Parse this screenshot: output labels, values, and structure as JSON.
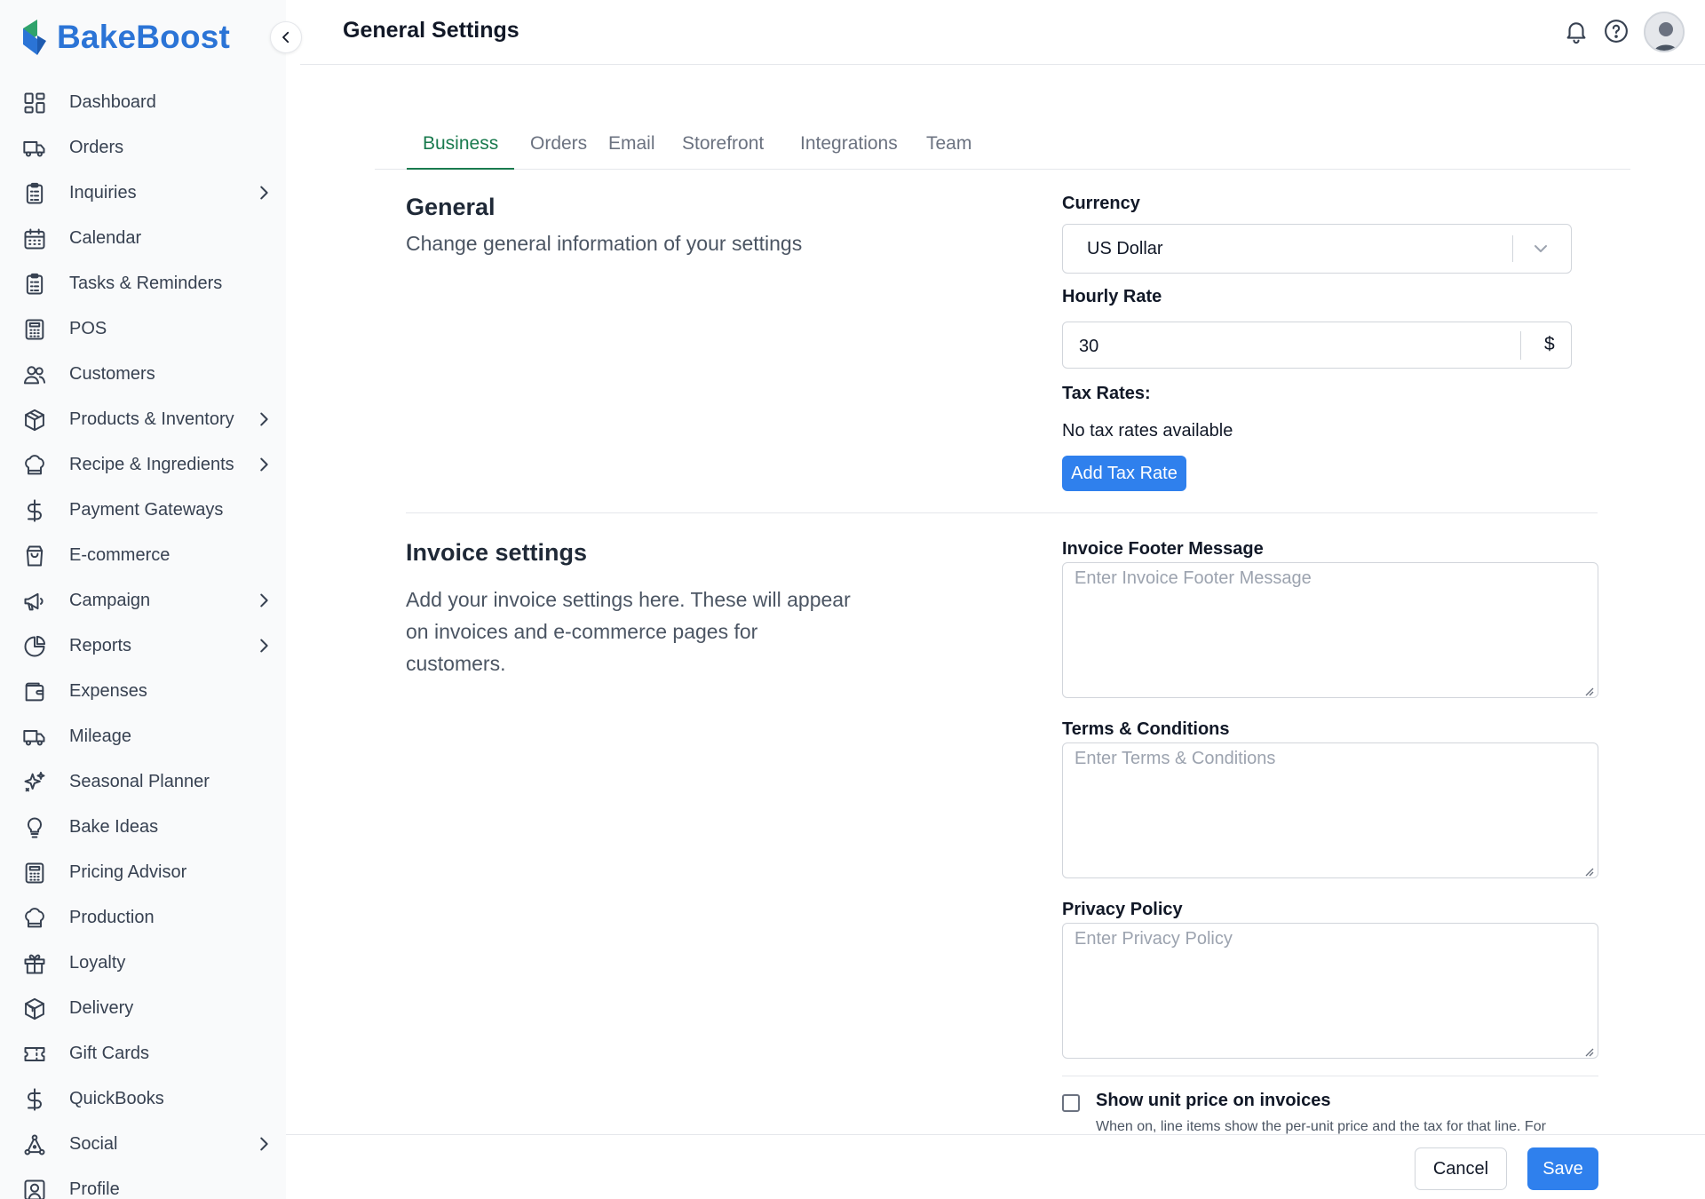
{
  "brand": {
    "name": "BakeBoost"
  },
  "sidebar": {
    "items": [
      {
        "label": "Dashboard",
        "icon": "dashboard-icon",
        "has_submenu": false
      },
      {
        "label": "Orders",
        "icon": "truck-icon",
        "has_submenu": false
      },
      {
        "label": "Inquiries",
        "icon": "clipboard-icon",
        "has_submenu": true
      },
      {
        "label": "Calendar",
        "icon": "calendar-icon",
        "has_submenu": false
      },
      {
        "label": "Tasks & Reminders",
        "icon": "clipboard-list-icon",
        "has_submenu": false
      },
      {
        "label": "POS",
        "icon": "calculator-icon",
        "has_submenu": false
      },
      {
        "label": "Customers",
        "icon": "users-icon",
        "has_submenu": false
      },
      {
        "label": "Products & Inventory",
        "icon": "box-icon",
        "has_submenu": true
      },
      {
        "label": "Recipe & Ingredients",
        "icon": "chef-hat-icon",
        "has_submenu": true
      },
      {
        "label": "Payment Gateways",
        "icon": "dollar-icon",
        "has_submenu": false
      },
      {
        "label": "E-commerce",
        "icon": "shopping-bag-icon",
        "has_submenu": false
      },
      {
        "label": "Campaign",
        "icon": "megaphone-icon",
        "has_submenu": true
      },
      {
        "label": "Reports",
        "icon": "pie-chart-icon",
        "has_submenu": true
      },
      {
        "label": "Expenses",
        "icon": "wallet-icon",
        "has_submenu": false
      },
      {
        "label": "Mileage",
        "icon": "truck-icon",
        "has_submenu": false
      },
      {
        "label": "Seasonal Planner",
        "icon": "sparkles-icon",
        "has_submenu": false
      },
      {
        "label": "Bake Ideas",
        "icon": "lightbulb-icon",
        "has_submenu": false
      },
      {
        "label": "Pricing Advisor",
        "icon": "calculator-icon",
        "has_submenu": false
      },
      {
        "label": "Production",
        "icon": "chef-hat-icon",
        "has_submenu": false
      },
      {
        "label": "Loyalty",
        "icon": "gift-icon",
        "has_submenu": false
      },
      {
        "label": "Delivery",
        "icon": "package-icon",
        "has_submenu": false
      },
      {
        "label": "Gift Cards",
        "icon": "ticket-icon",
        "has_submenu": false
      },
      {
        "label": "QuickBooks",
        "icon": "dollar-icon",
        "has_submenu": false
      },
      {
        "label": "Social",
        "icon": "share-nodes-icon",
        "has_submenu": true
      },
      {
        "label": "Profile",
        "icon": "user-square-icon",
        "has_submenu": false
      }
    ]
  },
  "header": {
    "title": "General Settings"
  },
  "tabs": [
    {
      "label": "Business",
      "active": true
    },
    {
      "label": "Orders",
      "active": false
    },
    {
      "label": "Email",
      "active": false
    },
    {
      "label": "Storefront",
      "active": false
    },
    {
      "label": "Integrations",
      "active": false
    },
    {
      "label": "Team",
      "active": false
    }
  ],
  "general": {
    "title": "General",
    "description": "Change general information of your settings",
    "currency_label": "Currency",
    "currency_value": "US Dollar",
    "hourly_rate_label": "Hourly Rate",
    "hourly_rate_value": "30",
    "hourly_rate_unit": "$",
    "tax_rates_label": "Tax Rates:",
    "tax_rates_empty": "No tax rates available",
    "add_tax_rate_label": "Add Tax Rate"
  },
  "invoice": {
    "title": "Invoice settings",
    "description_lines": [
      "Add your invoice settings here. These will appear",
      "on invoices and e-commerce pages for",
      "customers."
    ],
    "footer_label": "Invoice Footer Message",
    "footer_placeholder": "Enter Invoice Footer Message",
    "terms_label": "Terms & Conditions",
    "terms_placeholder": "Enter Terms & Conditions",
    "privacy_label": "Privacy Policy",
    "privacy_placeholder": "Enter Privacy Policy",
    "unit_price_label": "Show unit price on invoices",
    "unit_price_desc": "When on, line items show the per-unit price and the tax for that line. For",
    "unit_price_checked": false
  },
  "footer": {
    "cancel_label": "Cancel",
    "save_label": "Save"
  },
  "colors": {
    "brand": "#2b74d6",
    "active_tab": "#197a4e",
    "primary_button": "#2f80ed"
  }
}
